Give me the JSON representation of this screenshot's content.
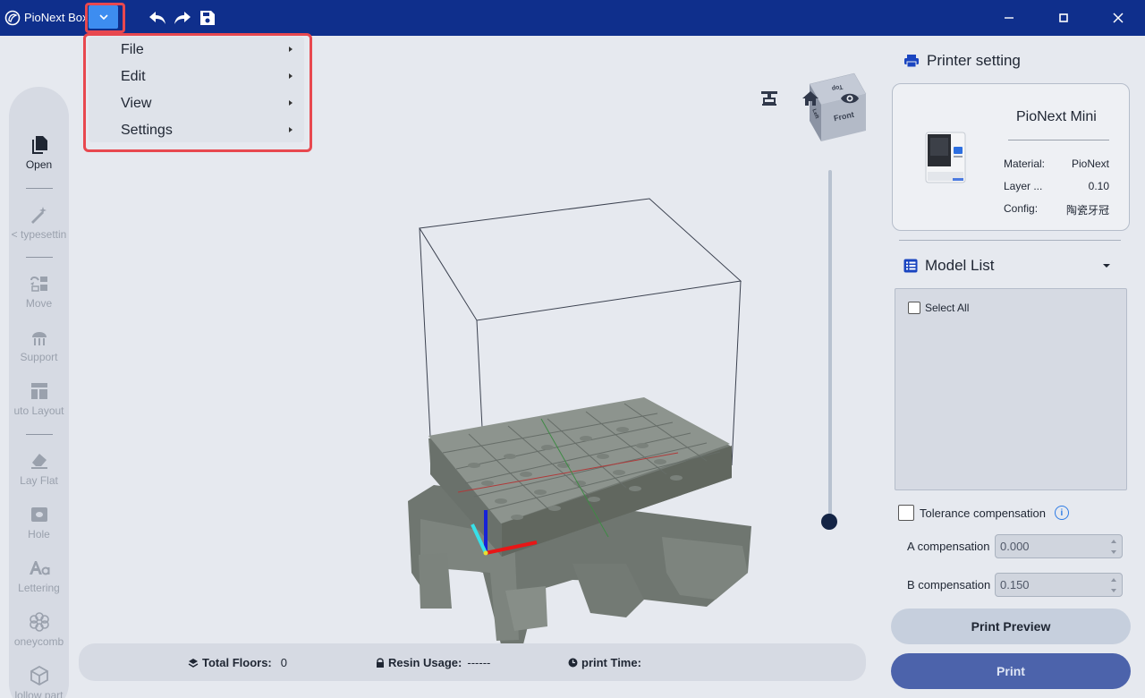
{
  "app": {
    "title": "PioNext Box"
  },
  "menu": {
    "items": [
      {
        "label": "File"
      },
      {
        "label": "Edit"
      },
      {
        "label": "View"
      },
      {
        "label": "Settings"
      }
    ]
  },
  "toolbar": {
    "tools": [
      {
        "label": "Open",
        "icon": "file-copy-icon"
      },
      {
        "label": "< typesettin",
        "icon": "magic-wand-icon"
      },
      {
        "label": "Move",
        "icon": "move-icon"
      },
      {
        "label": "Support",
        "icon": "support-icon"
      },
      {
        "label": "uto Layout",
        "icon": "layout-icon"
      },
      {
        "label": "Lay Flat",
        "icon": "eraser-icon"
      },
      {
        "label": "Hole",
        "icon": "hole-icon"
      },
      {
        "label": "Lettering",
        "icon": "lettering-icon"
      },
      {
        "label": "oneycomb",
        "icon": "flower-icon"
      },
      {
        "label": "lollow part",
        "icon": "cube-icon"
      }
    ]
  },
  "viewcube": {
    "front": "Front",
    "top": "Top",
    "left": "Left"
  },
  "status": {
    "floors_label": "Total Floors:",
    "floors_value": "0",
    "resin_label": "Resin Usage:",
    "resin_value": "------",
    "time_label": "print Time:",
    "time_value": ""
  },
  "printer_setting": {
    "title": "Printer setting",
    "printer_name": "PioNext Mini",
    "rows": [
      {
        "key": "Material:",
        "value": "PioNext"
      },
      {
        "key": "Layer ...",
        "value": "0.10"
      },
      {
        "key": "Config:",
        "value": "陶瓷牙冠"
      }
    ]
  },
  "model_list": {
    "title": "Model List",
    "select_all": "Select All"
  },
  "tolerance": {
    "label": "Tolerance compensation",
    "a_label": "A compensation",
    "a_value": "0.000",
    "b_label": "B compensation",
    "b_value": "0.150"
  },
  "buttons": {
    "preview": "Print Preview",
    "print": "Print"
  },
  "colors": {
    "titlebar": "#0f2f8c",
    "accent": "#3d8df0",
    "highlight": "#e8484f",
    "print_button": "#4c63ab"
  }
}
